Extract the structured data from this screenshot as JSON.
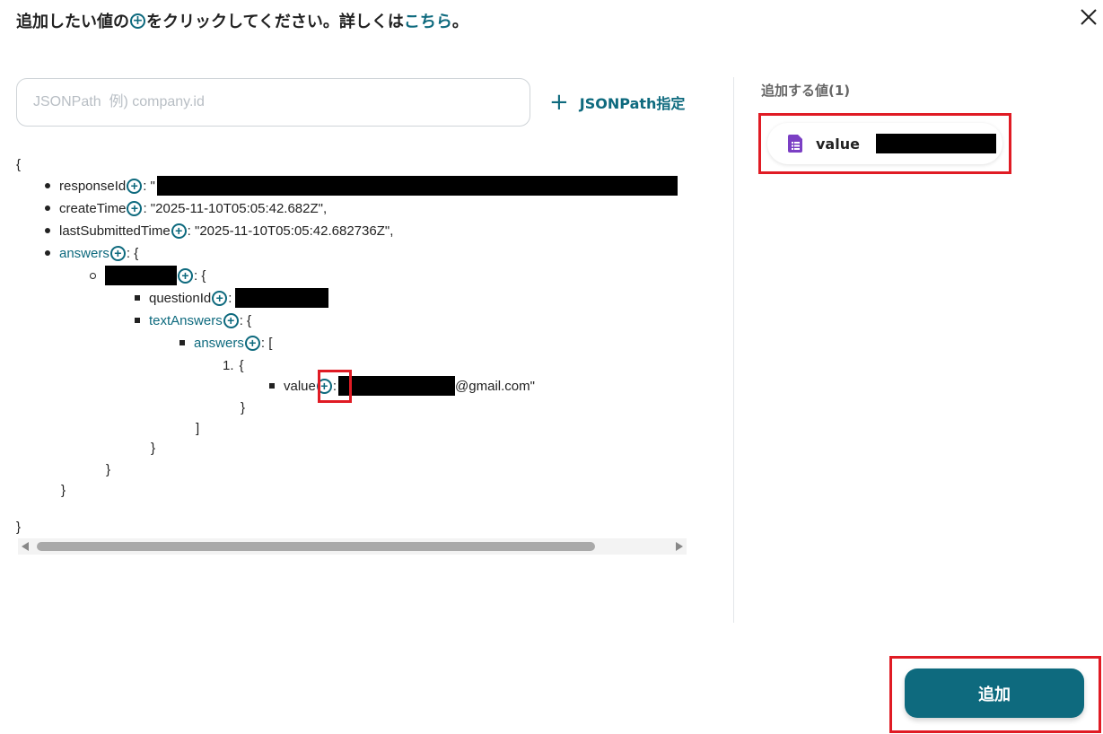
{
  "header": {
    "instruction_prefix": "追加したい値の",
    "instruction_suffix": "をクリックしてください。詳しくは",
    "help_link": "こちら",
    "period": "。"
  },
  "jsonpath": {
    "placeholder": "JSONPath  例) company.id",
    "button_label": "JSONPath指定"
  },
  "json_tree": {
    "open_brace": "{",
    "close_brace": "}",
    "colon_quote": ": \"",
    "colon_brace": ": {",
    "colon_bracket": ": [",
    "colon": ":",
    "brace_close": "}",
    "bracket_close": "]",
    "item_index": "1.",
    "responseId_key": "responseId",
    "createTime_key": "createTime",
    "createTime_value": ": \"2025-11-10T05:05:42.682Z\",",
    "lastSubmittedTime_key": "lastSubmittedTime",
    "lastSubmittedTime_value": ": \"2025-11-10T05:05:42.682736Z\",",
    "answers_key": "answers",
    "questionId_key": "questionId",
    "textAnswers_key": "textAnswers",
    "inner_answers_key": "answers",
    "value_key": "value",
    "value_suffix": "@gmail.com\""
  },
  "right_panel": {
    "title": "追加する値(1)",
    "chip_label": "value"
  },
  "footer": {
    "add_label": "追加"
  },
  "colors": {
    "accent": "#0e6a7e",
    "highlight": "#e01b24"
  },
  "icons": [
    "plus-circle-icon",
    "close-icon",
    "plus-icon",
    "form-doc-icon"
  ]
}
